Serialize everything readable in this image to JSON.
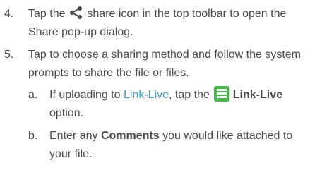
{
  "steps": [
    {
      "number": "4.",
      "text_before": "Tap the",
      "icon": "share-icon",
      "text_after": "share icon in the top toolbar to open the Share pop-up dialog."
    },
    {
      "number": "5.",
      "text": "Tap to choose a sharing method and follow the system prompts to share the file or files.",
      "substeps": [
        {
          "letter": "a.",
          "text_before": "If uploading to",
          "link": "Link-Live",
          "text_middle": ", tap the",
          "icon": "link-live-icon",
          "bold": "Link-Live",
          "text_after": "option."
        },
        {
          "letter": "b.",
          "text_before": "Enter any",
          "bold": "Comments",
          "text_after": "you would like attached to your file."
        }
      ]
    }
  ],
  "colors": {
    "link": "#3d9fd8",
    "icon_green": "#49b649",
    "text": "#4a4a4a"
  }
}
